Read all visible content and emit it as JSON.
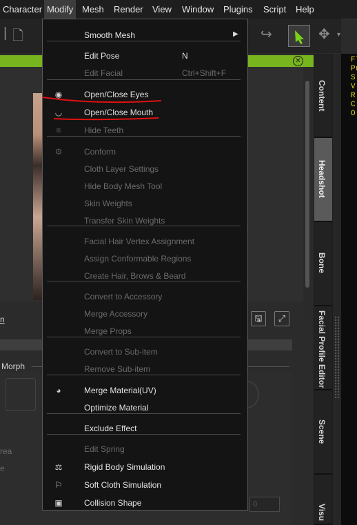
{
  "menubar": {
    "items": [
      "Character",
      "Modify",
      "Mesh",
      "Render",
      "View",
      "Window",
      "Plugins",
      "Script",
      "Help"
    ]
  },
  "side_tabs": [
    "Content",
    "Headshot",
    "Bone",
    "Facial Profile Editor",
    "Scene",
    "Visu"
  ],
  "console_lines": [
    "Fl",
    "Pr",
    "S",
    "V",
    "R",
    "C",
    "O"
  ],
  "viewport": {
    "left_link": "n",
    "morph_label": "Morph",
    "ghost_1": "rea",
    "ghost_2": "e",
    "spinner_value": "0"
  },
  "colors": {
    "accent_green": "#78b41e",
    "console_text": "#e6d51f",
    "annotation_red": "#e01010"
  },
  "modify_menu": {
    "groups": [
      [
        {
          "label": "Smooth Mesh",
          "enabled": true,
          "submenu": true,
          "arrow": "▶"
        }
      ],
      [
        {
          "label": "Edit Pose",
          "shortcut": "N",
          "enabled": true
        },
        {
          "label": "Edit Facial",
          "shortcut": "Ctrl+Shift+F",
          "enabled": false
        }
      ],
      [
        {
          "label": "Open/Close Eyes",
          "enabled": true,
          "icon": "eye-icon",
          "glyph": "◉"
        },
        {
          "label": "Open/Close Mouth",
          "enabled": true,
          "icon": "mouth-icon",
          "glyph": "◡"
        },
        {
          "label": "Hide Teeth",
          "enabled": false,
          "icon": "teeth-icon",
          "glyph": "≡"
        }
      ],
      [
        {
          "label": "Conform",
          "enabled": false,
          "icon": "conform-icon",
          "glyph": "⚙"
        },
        {
          "label": "Cloth Layer Settings",
          "enabled": false
        },
        {
          "label": "Hide Body Mesh Tool",
          "enabled": false
        },
        {
          "label": "Skin Weights",
          "enabled": false
        },
        {
          "label": "Transfer Skin Weights",
          "enabled": false
        }
      ],
      [
        {
          "label": "Facial Hair Vertex Assignment",
          "enabled": false
        },
        {
          "label": "Assign Conformable Regions",
          "enabled": false
        },
        {
          "label": "Create Hair, Brows & Beard",
          "enabled": false
        }
      ],
      [
        {
          "label": "Convert to Accessory",
          "enabled": false
        },
        {
          "label": "Merge Accessory",
          "enabled": false
        },
        {
          "label": "Merge Props",
          "enabled": false
        }
      ],
      [
        {
          "label": "Convert to Sub-item",
          "enabled": false
        },
        {
          "label": "Remove Sub-item",
          "enabled": false
        }
      ],
      [
        {
          "label": "Merge Material(UV)",
          "enabled": true,
          "icon": "merge-material-icon",
          "glyph": "◕"
        },
        {
          "label": "Optimize Material",
          "enabled": true
        }
      ],
      [
        {
          "label": "Exclude Effect",
          "enabled": true
        }
      ],
      [
        {
          "label": "Edit Spring",
          "enabled": false
        },
        {
          "label": "Rigid Body Simulation",
          "enabled": true,
          "icon": "rigid-body-icon",
          "glyph": "⚖"
        },
        {
          "label": "Soft Cloth Simulation",
          "enabled": true,
          "icon": "flag-icon",
          "glyph": "⚐"
        },
        {
          "label": "Collision Shape",
          "enabled": true,
          "icon": "collision-shape-icon",
          "glyph": "▣"
        }
      ]
    ]
  }
}
